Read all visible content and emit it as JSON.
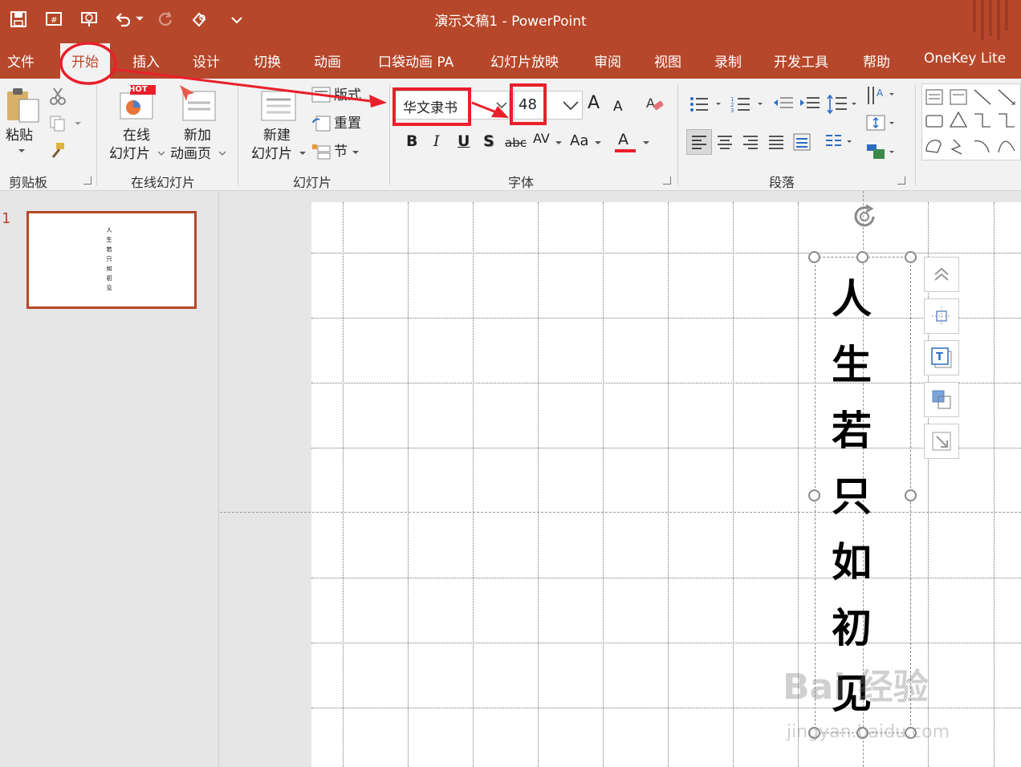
{
  "app": {
    "doc_title": "演示文稿1  -  PowerPoint"
  },
  "colors": {
    "brand": "#b7472a",
    "highlight": "#e8202a"
  },
  "quick_access": [
    "save-icon",
    "present-icon",
    "start-from-beginning-icon",
    "undo-icon",
    "redo-icon",
    "touch-mode-icon",
    "customize-dropdown-icon"
  ],
  "tabs": [
    "文件",
    "开始",
    "插入",
    "设计",
    "切换",
    "动画",
    "口袋动画 PA",
    "幻灯片放映",
    "审阅",
    "视图",
    "录制",
    "开发工具",
    "帮助",
    "OneKey Lite"
  ],
  "active_tab": "开始",
  "ribbon": {
    "clipboard": {
      "label": "剪贴板",
      "paste": "粘贴"
    },
    "online": {
      "label": "在线幻灯片",
      "online_slides_1": "在线",
      "online_slides_2": "幻灯片",
      "hot": "HOT",
      "new_anim_1": "新加",
      "new_anim_2": "动画页"
    },
    "slides": {
      "label": "幻灯片",
      "new_slide_1": "新建",
      "new_slide_2": "幻灯片",
      "layout": "版式",
      "reset": "重置",
      "section": "节"
    },
    "font": {
      "label": "字体",
      "name": "华文隶书",
      "size": "48",
      "bold": "B",
      "italic": "I",
      "underline": "U",
      "shadow": "S",
      "strike": "abc",
      "spacing": "AV",
      "case": "Aa",
      "color": "A",
      "grow": "A",
      "shrink": "A"
    },
    "paragraph": {
      "label": "段落"
    }
  },
  "slides_pane": {
    "slide_number": "1",
    "thumb_text": "人生若只如初见"
  },
  "slide": {
    "vertical_text": "人生若只如初见"
  },
  "watermark": {
    "main": "Bai 经验",
    "sub": "jingyan.baidu.com"
  }
}
